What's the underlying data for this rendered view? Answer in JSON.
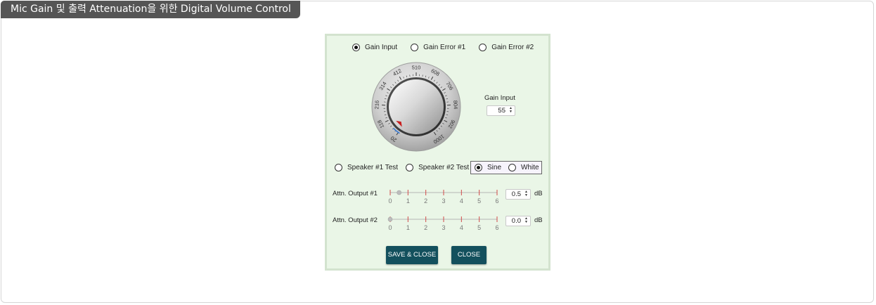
{
  "window": {
    "title": "Mic Gain 및 출력 Attenuation을 위한 Digital Volume Control"
  },
  "mode_selector": {
    "options": [
      {
        "label": "Gain Input",
        "selected": true
      },
      {
        "label": "Gain Error #1",
        "selected": false
      },
      {
        "label": "Gain Error #2",
        "selected": false
      }
    ]
  },
  "knob": {
    "scale_labels": [
      "20",
      "118",
      "216",
      "314",
      "412",
      "510",
      "608",
      "706",
      "804",
      "902",
      "1000"
    ],
    "min": 20,
    "max": 1000,
    "value": 55
  },
  "gain_input": {
    "label": "Gain Input",
    "value": "55"
  },
  "speaker_test": {
    "options": [
      {
        "label": "Speaker #1 Test",
        "selected": false
      },
      {
        "label": "Speaker #2 Test",
        "selected": false
      }
    ]
  },
  "waveform": {
    "options": [
      {
        "label": "Sine",
        "selected": true
      },
      {
        "label": "White",
        "selected": false
      }
    ]
  },
  "attn_outputs": [
    {
      "label": "Attn. Output #1",
      "value": "0.5",
      "unit": "dB",
      "level": 0.5
    },
    {
      "label": "Attn. Output #2",
      "value": "0.0",
      "unit": "dB",
      "level": 0.0
    }
  ],
  "slider_ticks": [
    "0",
    "1",
    "2",
    "3",
    "4",
    "5",
    "6"
  ],
  "slider_range": [
    0,
    6
  ],
  "buttons": {
    "save_close": "SAVE & CLOSE",
    "close": "CLOSE"
  },
  "colors": {
    "dialog_bg": "#eaf6e7",
    "button_bg": "#13505d",
    "title_bg": "#555555",
    "tick_red": "#d24a4a"
  }
}
